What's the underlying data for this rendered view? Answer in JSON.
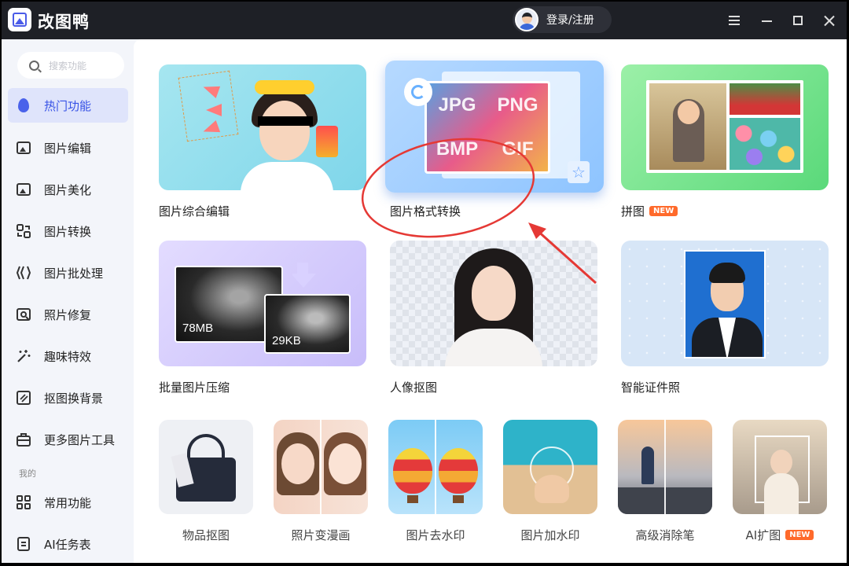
{
  "app": {
    "title": "改图鸭",
    "login_label": "登录/注册"
  },
  "sidebar": {
    "search_placeholder": "搜索功能",
    "items": [
      {
        "label": "热门功能",
        "icon": "flame-icon",
        "active": true
      },
      {
        "label": "图片编辑",
        "icon": "image-edit-icon"
      },
      {
        "label": "图片美化",
        "icon": "image-beautify-icon"
      },
      {
        "label": "图片转换",
        "icon": "convert-icon"
      },
      {
        "label": "图片批处理",
        "icon": "batch-icon"
      },
      {
        "label": "照片修复",
        "icon": "photo-repair-icon"
      },
      {
        "label": "趣味特效",
        "icon": "magic-wand-icon"
      },
      {
        "label": "抠图换背景",
        "icon": "cutout-icon"
      },
      {
        "label": "更多图片工具",
        "icon": "toolbox-icon"
      }
    ],
    "section_mine": "我的",
    "mine_items": [
      {
        "label": "常用功能",
        "icon": "grid-icon"
      },
      {
        "label": "AI任务表",
        "icon": "document-icon"
      }
    ]
  },
  "cards_large": [
    {
      "label": "图片综合编辑"
    },
    {
      "label": "图片格式转换",
      "formats": [
        "JPG",
        "PNG",
        "BMP",
        "GIF"
      ]
    },
    {
      "label": "拼图",
      "badge": "NEW"
    },
    {
      "label": "批量图片压缩",
      "size_before": "78MB",
      "size_after": "29KB"
    },
    {
      "label": "人像抠图"
    },
    {
      "label": "智能证件照"
    }
  ],
  "cards_small": [
    {
      "label": "物品抠图"
    },
    {
      "label": "照片变漫画"
    },
    {
      "label": "图片去水印"
    },
    {
      "label": "图片加水印"
    },
    {
      "label": "高级消除笔"
    },
    {
      "label": "AI扩图",
      "badge": "NEW"
    }
  ],
  "colors": {
    "accent": "#3752e6",
    "annotation": "#e53935",
    "titlebar": "#1e2026",
    "badge": "#ff6a2b"
  }
}
